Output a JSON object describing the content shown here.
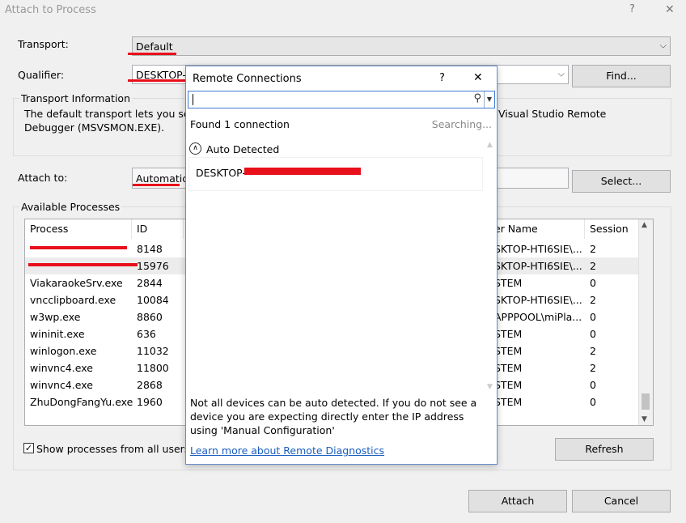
{
  "window": {
    "title": "Attach to Process",
    "help_glyph": "?",
    "close_glyph": "✕"
  },
  "transport": {
    "label": "Transport:",
    "value": "Default"
  },
  "qualifier": {
    "label": "Qualifier:",
    "value": "DESKTOP-",
    "find_label": "Find..."
  },
  "transport_info": {
    "heading": "Transport Information",
    "line1": "The default transport lets you sele",
    "line1_tail": "Visual Studio Remote",
    "line2": "Debugger (MSVSMON.EXE)."
  },
  "attach_to": {
    "label": "Attach to:",
    "value": "Automatic:",
    "select_label": "Select..."
  },
  "available": {
    "heading": "Available Processes",
    "columns": {
      "process": "Process",
      "id": "ID",
      "user": "er Name",
      "session": "Session"
    },
    "rows": [
      {
        "process": "",
        "id": "8148",
        "user": "SKTOP-HTI6SIE\\...",
        "session": "2"
      },
      {
        "process": "",
        "id": "15976",
        "user": "SKTOP-HTI6SIE\\...",
        "session": "2"
      },
      {
        "process": "ViakaraokeSrv.exe",
        "id": "2844",
        "user": "STEM",
        "session": "0"
      },
      {
        "process": "vncclipboard.exe",
        "id": "10084",
        "user": "SKTOP-HTI6SIE\\...",
        "session": "2"
      },
      {
        "process": "w3wp.exe",
        "id": "8860",
        "user": "APPPOOL\\miPla...",
        "session": "0"
      },
      {
        "process": "wininit.exe",
        "id": "636",
        "user": "STEM",
        "session": "0"
      },
      {
        "process": "winlogon.exe",
        "id": "11032",
        "user": "STEM",
        "session": "2"
      },
      {
        "process": "winvnc4.exe",
        "id": "11800",
        "user": "STEM",
        "session": "2"
      },
      {
        "process": "winvnc4.exe",
        "id": "2868",
        "user": "STEM",
        "session": "0"
      },
      {
        "process": "ZhuDongFangYu.exe",
        "id": "1960",
        "user": "STEM",
        "session": "0"
      }
    ]
  },
  "show_all": {
    "label": "Show processes from all users",
    "checked": true
  },
  "buttons": {
    "refresh": "Refresh",
    "attach": "Attach",
    "cancel": "Cancel"
  },
  "remote": {
    "title": "Remote Connections",
    "help_glyph": "?",
    "close_glyph": "✕",
    "search_value": "",
    "found": "Found 1 connection",
    "status": "Searching...",
    "group": "Auto Detected",
    "item": "DESKTOP-",
    "note": "Not all devices can be auto detected. If you do not see a device you are expecting directly enter the IP address using 'Manual Configuration'",
    "link": "Learn more about Remote Diagnostics"
  }
}
